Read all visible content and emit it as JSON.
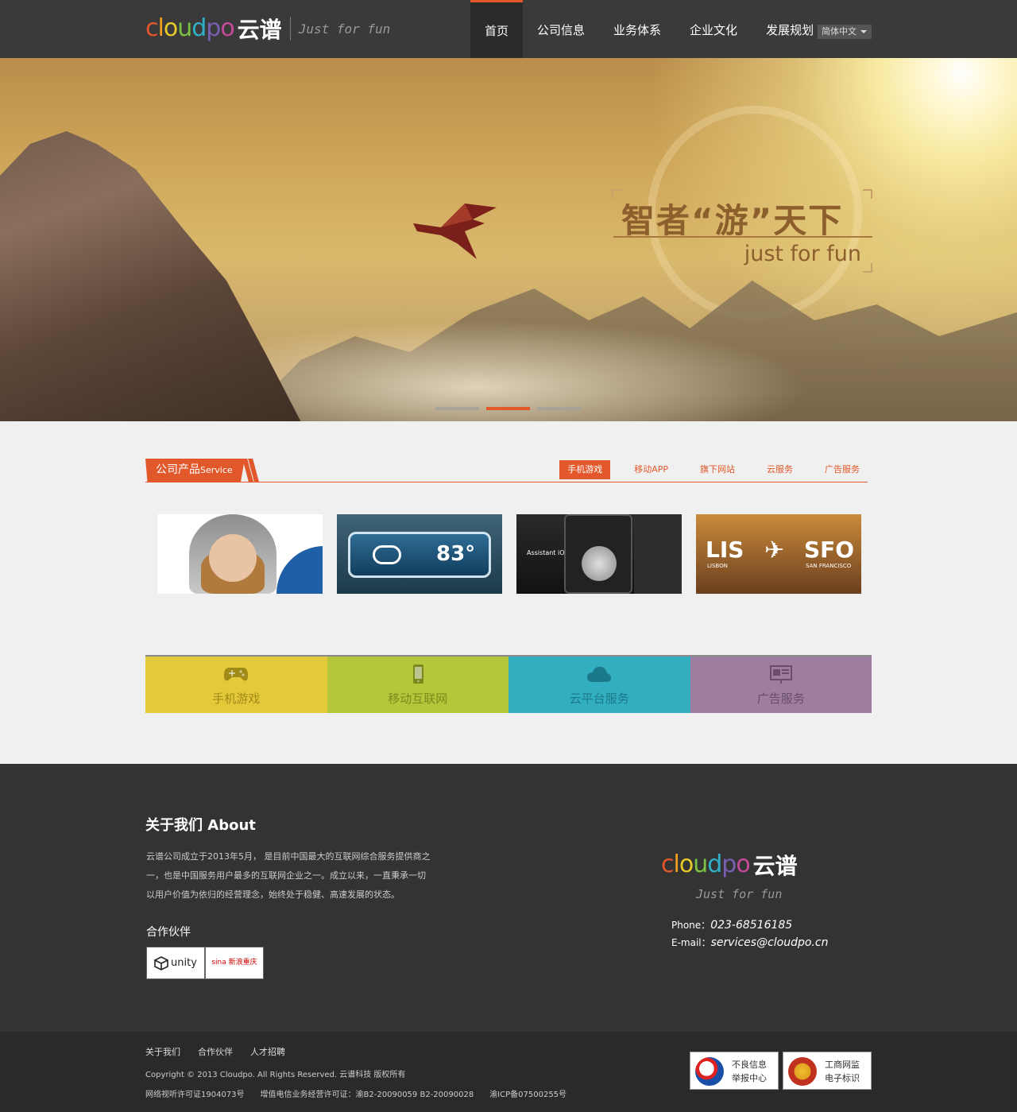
{
  "header": {
    "logo_letters": [
      {
        "ch": "c",
        "color": "#e2582a"
      },
      {
        "ch": "l",
        "color": "#f0a01e"
      },
      {
        "ch": "o",
        "color": "#e8c92a"
      },
      {
        "ch": "u",
        "color": "#7cc242"
      },
      {
        "ch": "d",
        "color": "#2fb1c7"
      },
      {
        "ch": "p",
        "color": "#7a5fb0"
      },
      {
        "ch": "o",
        "color": "#c64a9a"
      }
    ],
    "logo_cn": "云谱",
    "slogan": "Just for fun",
    "nav": [
      "首页",
      "公司信息",
      "业务体系",
      "企业文化",
      "发展规划"
    ],
    "language": "简体中文"
  },
  "banner": {
    "headline": "智者“游”天下",
    "subline": "just for fun",
    "slides": 3,
    "active_slide": 2
  },
  "products": {
    "title": "公司产品",
    "title_en": "Service",
    "tabs": [
      "手机游戏",
      "移动APP",
      "旗下网站",
      "云服务",
      "广告服务"
    ],
    "active_tab": 0,
    "thumb_weather_temp": "83°",
    "thumb_app_text": "Assistant iOS App",
    "thumb_flight": {
      "from": "LIS",
      "from_city": "LISBON",
      "to": "SFO",
      "to_city": "SAN FRANCISCO"
    }
  },
  "categories": [
    {
      "label": "手机游戏",
      "icon": "gamepad-icon",
      "bg": "#e4c93a",
      "fg": "#a08a18"
    },
    {
      "label": "移动互联网",
      "icon": "mobile-phone-icon",
      "bg": "#b5c63a",
      "fg": "#7a8a1c"
    },
    {
      "label": "云平台服务",
      "icon": "cloud-icon",
      "bg": "#33adc0",
      "fg": "#1a7a8a"
    },
    {
      "label": "广告服务",
      "icon": "billboard-icon",
      "bg": "#9d7ea0",
      "fg": "#6a4d6e"
    }
  ],
  "footer": {
    "about_title": "关于我们 About",
    "about_text": "云谱公司成立于2013年5月， 是目前中国最大的互联网综合服务提供商之一，也是中国服务用户最多的互联网企业之一。成立以来，一直秉承一切以用户价值为依归的经营理念，始终处于稳健、高速发展的状态。",
    "partners_title": "合作伙伴",
    "partners": [
      "unity",
      "sina 新浪重庆"
    ],
    "logo_cn": "云谱",
    "slogan": "Just for fun",
    "phone_label": "Phone：",
    "phone": "023-68516185",
    "email_label": "E-mail：",
    "email": "services@cloudpo.cn"
  },
  "bottom": {
    "links": [
      "关于我们",
      "合作伙伴",
      "人才招聘"
    ],
    "copyright": "Copyright © 2013  Cloudpo. All Rights Reserved.  云谱科技  版权所有",
    "licenses": [
      "网络视听许可证1904073号",
      "增值电信业务经营许可证：渝B2-20090059 B2-20090028",
      "渝ICP备07500255号"
    ],
    "badges": [
      {
        "line1": "不良信息",
        "line2": "举报中心"
      },
      {
        "line1": "工商网监",
        "line2": "电子标识"
      }
    ]
  }
}
